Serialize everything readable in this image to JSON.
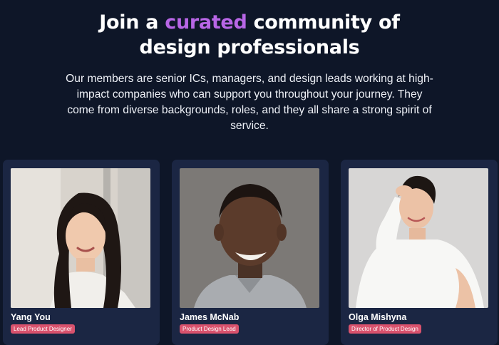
{
  "hero": {
    "title_prefix": "Join a ",
    "title_accent": "curated",
    "title_suffix": " community of",
    "title_line2": "design professionals",
    "description": "Our members are senior ICs, managers, and design leads working at high-impact companies who can support you throughout your journey. They come from diverse backgrounds, roles, and they all share a strong spirit of service."
  },
  "members": [
    {
      "name": "Yang You",
      "role": "Lead Product Designer"
    },
    {
      "name": "James McNab",
      "role": "Product Design Lead"
    },
    {
      "name": "Olga Mishyna",
      "role": "Director of Product Design"
    }
  ],
  "colors": {
    "background": "#0e1628",
    "card": "#1b2643",
    "accent": "#b866e6",
    "role_badge": "#d9526d"
  }
}
